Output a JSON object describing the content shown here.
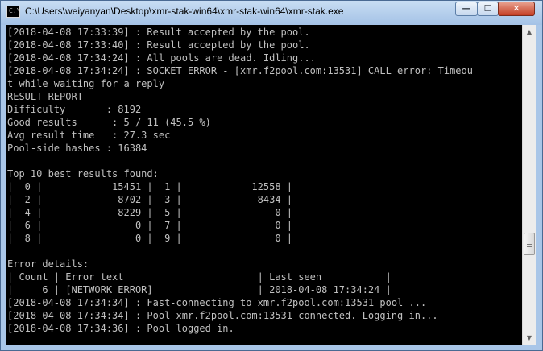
{
  "window": {
    "title": "C:\\Users\\weiyanyan\\Desktop\\xmr-stak-win64\\xmr-stak-win64\\xmr-stak.exe",
    "icon": "console-app-icon",
    "icon_glyph": "C:\\",
    "minimize_glyph": "—",
    "maximize_glyph": "☐",
    "close_glyph": "✕"
  },
  "scrollbar": {
    "up_glyph": "▲",
    "down_glyph": "▼",
    "position": 0.72
  },
  "console": {
    "lines": [
      "[2018-04-08 17:33:39] : Result accepted by the pool.",
      "[2018-04-08 17:33:40] : Result accepted by the pool.",
      "[2018-04-08 17:34:24] : All pools are dead. Idling...",
      "[2018-04-08 17:34:24] : SOCKET ERROR - [xmr.f2pool.com:13531] CALL error: Timeou",
      "t while waiting for a reply",
      "RESULT REPORT",
      "Difficulty       : 8192",
      "Good results      : 5 / 11 (45.5 %)",
      "Avg result time   : 27.3 sec",
      "Pool-side hashes : 16384",
      "",
      "Top 10 best results found:",
      "|  0 |            15451 |  1 |            12558 |",
      "|  2 |             8702 |  3 |             8434 |",
      "|  4 |             8229 |  5 |                0 |",
      "|  6 |                0 |  7 |                0 |",
      "|  8 |                0 |  9 |                0 |",
      "",
      "Error details:",
      "| Count | Error text                       | Last seen           |",
      "|     6 | [NETWORK ERROR]                  | 2018-04-08 17:34:24 |",
      "[2018-04-08 17:34:34] : Fast-connecting to xmr.f2pool.com:13531 pool ...",
      "[2018-04-08 17:34:34] : Pool xmr.f2pool.com:13531 connected. Logging in...",
      "[2018-04-08 17:34:36] : Pool logged in."
    ]
  },
  "colors": {
    "console_background": "#000000",
    "console_text": "#c0c0c0",
    "title_bar": "#b9d1ea",
    "close_button": "#c43e24"
  }
}
